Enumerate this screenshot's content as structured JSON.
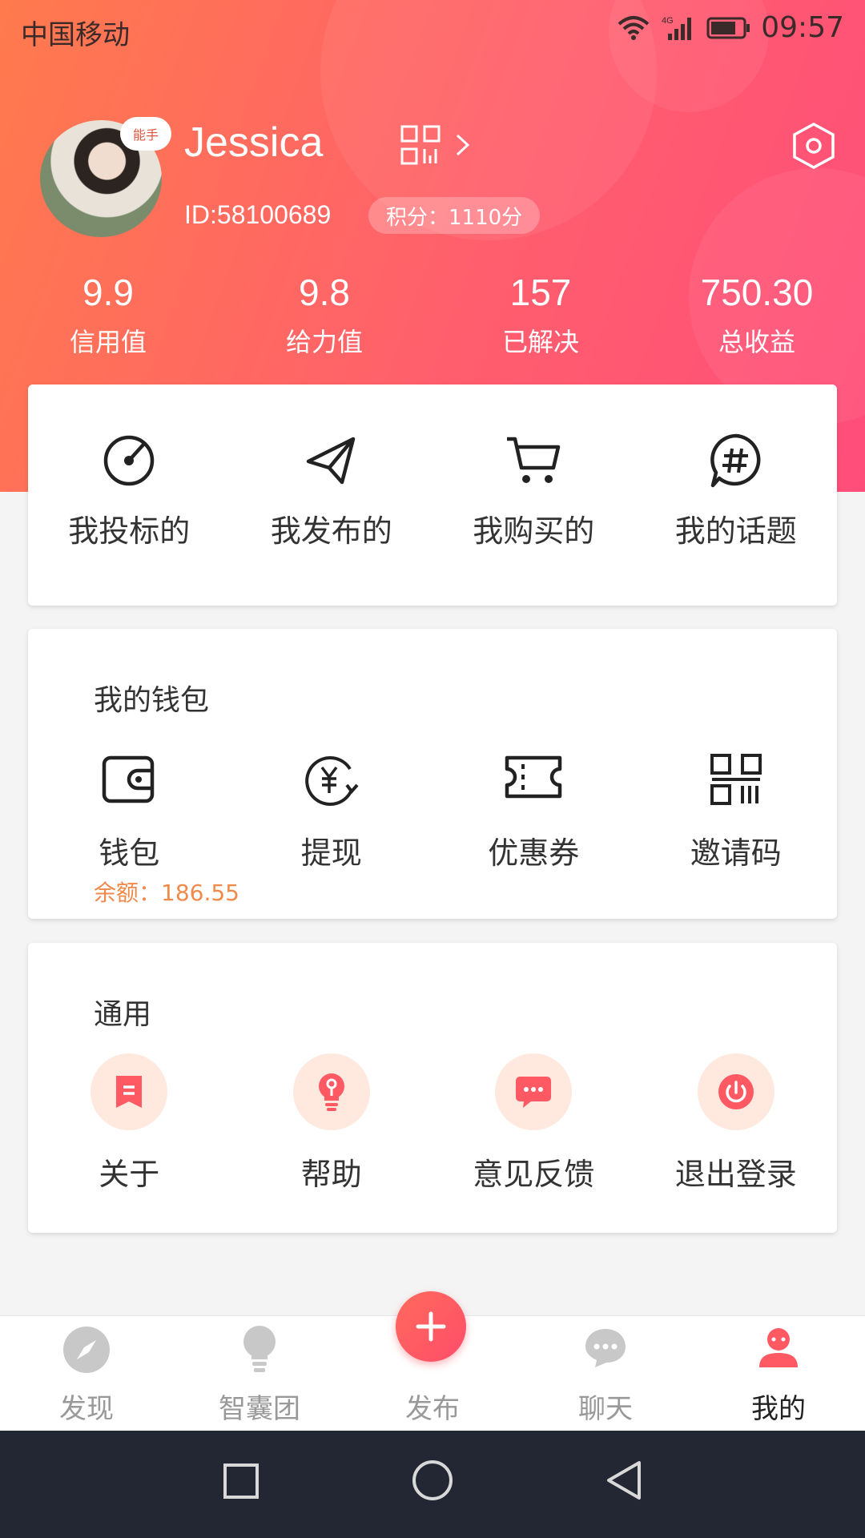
{
  "status": {
    "carrier": "中国移动",
    "network": "4G",
    "time": "09:57"
  },
  "profile": {
    "badge": "能手",
    "name": "Jessica",
    "id": "ID:58100689",
    "points": "积分：1110分"
  },
  "stats": [
    {
      "value": "9.9",
      "label": "信用值"
    },
    {
      "value": "9.8",
      "label": "给力值"
    },
    {
      "value": "157",
      "label": "已解决"
    },
    {
      "value": "750.30",
      "label": "总收益"
    }
  ],
  "quick": [
    {
      "label": "我投标的",
      "icon": "bid-icon"
    },
    {
      "label": "我发布的",
      "icon": "paper-plane-icon"
    },
    {
      "label": "我购买的",
      "icon": "cart-icon"
    },
    {
      "label": "我的话题",
      "icon": "hashtag-icon"
    }
  ],
  "wallet": {
    "title": "我的钱包",
    "items": [
      {
        "label": "钱包",
        "icon": "wallet-icon"
      },
      {
        "label": "提现",
        "icon": "yuan-withdraw-icon"
      },
      {
        "label": "优惠券",
        "icon": "ticket-icon"
      },
      {
        "label": "邀请码",
        "icon": "qrcode-icon"
      }
    ],
    "balance": "余额：186.55"
  },
  "general": {
    "title": "通用",
    "items": [
      {
        "label": "关于",
        "icon": "bookmark-icon"
      },
      {
        "label": "帮助",
        "icon": "bulb-icon"
      },
      {
        "label": "意见反馈",
        "icon": "chat-dots-icon"
      },
      {
        "label": "退出登录",
        "icon": "power-icon"
      }
    ]
  },
  "tabs": [
    {
      "label": "发现",
      "icon": "compass-icon"
    },
    {
      "label": "智囊团",
      "icon": "bulb-icon"
    },
    {
      "label": "发布",
      "icon": "plus-icon"
    },
    {
      "label": "聊天",
      "icon": "chat-icon"
    },
    {
      "label": "我的",
      "icon": "user-icon",
      "active": true
    }
  ],
  "colors": {
    "accent": "#ff5a64",
    "gradient_start": "#ff7a4d",
    "gradient_end": "#ff4d7a",
    "balance": "#f08a4b"
  }
}
